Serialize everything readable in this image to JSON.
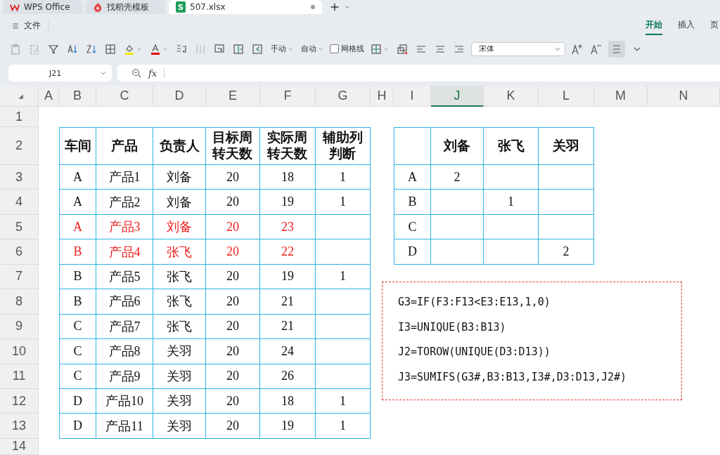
{
  "app_tabs": [
    {
      "label": "WPS Office",
      "kind": "home",
      "selected": false
    },
    {
      "label": "找稻壳模板",
      "kind": "template",
      "selected": false
    },
    {
      "label": "507.xlsx",
      "kind": "sheet",
      "badge": "S",
      "selected": true
    }
  ],
  "file_menu": {
    "label": "文件"
  },
  "ribbon_tabs": [
    {
      "label": "开始",
      "selected": true
    },
    {
      "label": "插入",
      "selected": false
    },
    {
      "label": "页",
      "selected": false
    }
  ],
  "toolbar": {
    "row_height": "手动",
    "column_width": "自动",
    "gridlines": {
      "label": "网格线",
      "checked": false
    },
    "font": "宋体"
  },
  "name_box": "J21",
  "formula_label": "fx",
  "sheet": {
    "columns": [
      {
        "label": "A",
        "selected": false
      },
      {
        "label": "B",
        "selected": false
      },
      {
        "label": "C",
        "selected": false
      },
      {
        "label": "D",
        "selected": false
      },
      {
        "label": "E",
        "selected": false
      },
      {
        "label": "F",
        "selected": false
      },
      {
        "label": "G",
        "selected": false
      },
      {
        "label": "H",
        "selected": false
      },
      {
        "label": "I",
        "selected": false
      },
      {
        "label": "J",
        "selected": true
      },
      {
        "label": "K",
        "selected": false
      },
      {
        "label": "L",
        "selected": false
      },
      {
        "label": "M",
        "selected": false
      },
      {
        "label": "N",
        "selected": false
      }
    ],
    "rows": [
      "1",
      "2",
      "3",
      "4",
      "5",
      "6",
      "7",
      "8",
      "9",
      "10",
      "11",
      "12",
      "13",
      "14"
    ],
    "table_1": {
      "headers": [
        "车间",
        "产品",
        "负责人",
        "目标周转天数",
        "实际周转天数",
        "辅助列判断"
      ],
      "rows": [
        {
          "cells": [
            "A",
            "产品1",
            "刘备",
            "20",
            "18",
            "1"
          ],
          "flagged": false
        },
        {
          "cells": [
            "A",
            "产品2",
            "刘备",
            "20",
            "19",
            "1"
          ],
          "flagged": false
        },
        {
          "cells": [
            "A",
            "产品3",
            "刘备",
            "20",
            "23",
            ""
          ],
          "flagged": true
        },
        {
          "cells": [
            "B",
            "产品4",
            "张飞",
            "20",
            "22",
            ""
          ],
          "flagged": true
        },
        {
          "cells": [
            "B",
            "产品5",
            "张飞",
            "20",
            "19",
            "1"
          ],
          "flagged": false
        },
        {
          "cells": [
            "B",
            "产品6",
            "张飞",
            "20",
            "21",
            ""
          ],
          "flagged": false
        },
        {
          "cells": [
            "C",
            "产品7",
            "张飞",
            "20",
            "21",
            ""
          ],
          "flagged": false
        },
        {
          "cells": [
            "C",
            "产品8",
            "关羽",
            "20",
            "24",
            ""
          ],
          "flagged": false
        },
        {
          "cells": [
            "C",
            "产品9",
            "关羽",
            "20",
            "26",
            ""
          ],
          "flagged": false
        },
        {
          "cells": [
            "D",
            "产品10",
            "关羽",
            "20",
            "18",
            "1"
          ],
          "flagged": false
        },
        {
          "cells": [
            "D",
            "产品11",
            "关羽",
            "20",
            "19",
            "1"
          ],
          "flagged": false
        }
      ]
    },
    "table_2": {
      "headers": [
        "刘备",
        "张飞",
        "关羽"
      ],
      "rows": [
        {
          "cells": [
            "A",
            "2",
            "",
            ""
          ]
        },
        {
          "cells": [
            "B",
            "",
            "1",
            ""
          ]
        },
        {
          "cells": [
            "C",
            "",
            "",
            ""
          ]
        },
        {
          "cells": [
            "D",
            "",
            "",
            "2"
          ]
        }
      ]
    },
    "note": {
      "lines": [
        "G3=IF(F3:F13<E3:E13,1,0)",
        "I3=UNIQUE(B3:B13)",
        "J2=TOROW(UNIQUE(D3:D13))",
        "J3=SUMIFS(G3#,B3:B13,I3#,D3:D13,J2#)"
      ]
    }
  }
}
